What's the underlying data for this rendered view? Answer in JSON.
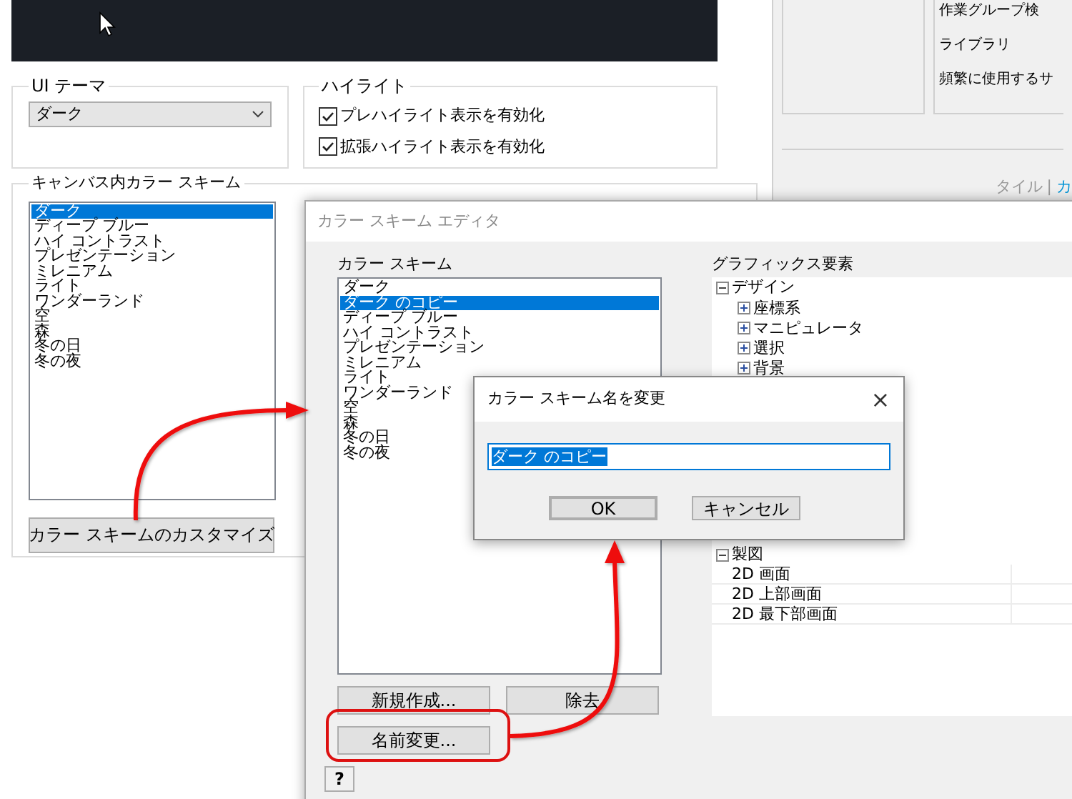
{
  "settings_window": {
    "ui_theme": {
      "label": "UI テーマ",
      "value": "ダーク"
    },
    "highlight": {
      "label": "ハイライト",
      "options": [
        {
          "label": "プレハイライト表示を有効化",
          "checked": true
        },
        {
          "label": "拡張ハイライト表示を有効化",
          "checked": true
        }
      ]
    },
    "canvas_color_scheme": {
      "label": "キャンバス内カラー スキーム",
      "items": [
        {
          "label": "ダーク",
          "selected": true
        },
        {
          "label": "ディープ ブルー",
          "selected": false
        },
        {
          "label": "ハイ コントラスト",
          "selected": false
        },
        {
          "label": "プレゼンテーション",
          "selected": false
        },
        {
          "label": "ミレニアム",
          "selected": false
        },
        {
          "label": "ライト",
          "selected": false
        },
        {
          "label": "ワンダーランド",
          "selected": false
        },
        {
          "label": "空",
          "selected": false
        },
        {
          "label": "森",
          "selected": false
        },
        {
          "label": "冬の日",
          "selected": false
        },
        {
          "label": "冬の夜",
          "selected": false
        }
      ],
      "button": "カラー スキームのカスタマイズ"
    }
  },
  "side_panel": {
    "items": [
      "作業グループ検",
      "ライブラリ",
      "頻繁に使用するサ"
    ],
    "view_links": [
      {
        "label": "タイル",
        "selected": false
      },
      {
        "label": "カ",
        "selected": true
      }
    ],
    "separator": "|"
  },
  "editor": {
    "title": "カラー スキーム エディタ",
    "schemes_label": "カラー スキーム",
    "schemes": [
      {
        "label": "ダーク",
        "selected": false
      },
      {
        "label": "ダーク のコピー",
        "selected": true
      },
      {
        "label": "ディープ ブルー",
        "selected": false
      },
      {
        "label": "ハイ コントラスト",
        "selected": false
      },
      {
        "label": "プレゼンテーション",
        "selected": false
      },
      {
        "label": "ミレニアム",
        "selected": false
      },
      {
        "label": "ライト",
        "selected": false
      },
      {
        "label": "ワンダーランド",
        "selected": false
      },
      {
        "label": "空",
        "selected": false
      },
      {
        "label": "森",
        "selected": false
      },
      {
        "label": "冬の日",
        "selected": false
      },
      {
        "label": "冬の夜",
        "selected": false
      }
    ],
    "buttons": [
      "新規作成...",
      "除去",
      "名前変更..."
    ],
    "help_button": "?",
    "graphics_label": "グラフィックス要素",
    "tree": [
      {
        "label": "デザイン",
        "expanded": true,
        "children": [
          {
            "label": "座標系",
            "expanded": false
          },
          {
            "label": "マニピュレータ",
            "expanded": false
          },
          {
            "label": "選択",
            "expanded": false
          },
          {
            "label": "背景",
            "expanded": false
          }
        ]
      },
      {
        "label": "製図",
        "expanded": true,
        "children": [
          {
            "label": "2D 画面"
          },
          {
            "label": "2D 上部画面"
          },
          {
            "label": "2D 最下部画面"
          }
        ]
      }
    ]
  },
  "rename_dialog": {
    "title": "カラー スキーム名を変更",
    "close": "×",
    "value": "ダーク のコピー",
    "buttons": [
      {
        "label": "OK",
        "default": true
      },
      {
        "label": "キャンセル",
        "default": false
      }
    ]
  }
}
